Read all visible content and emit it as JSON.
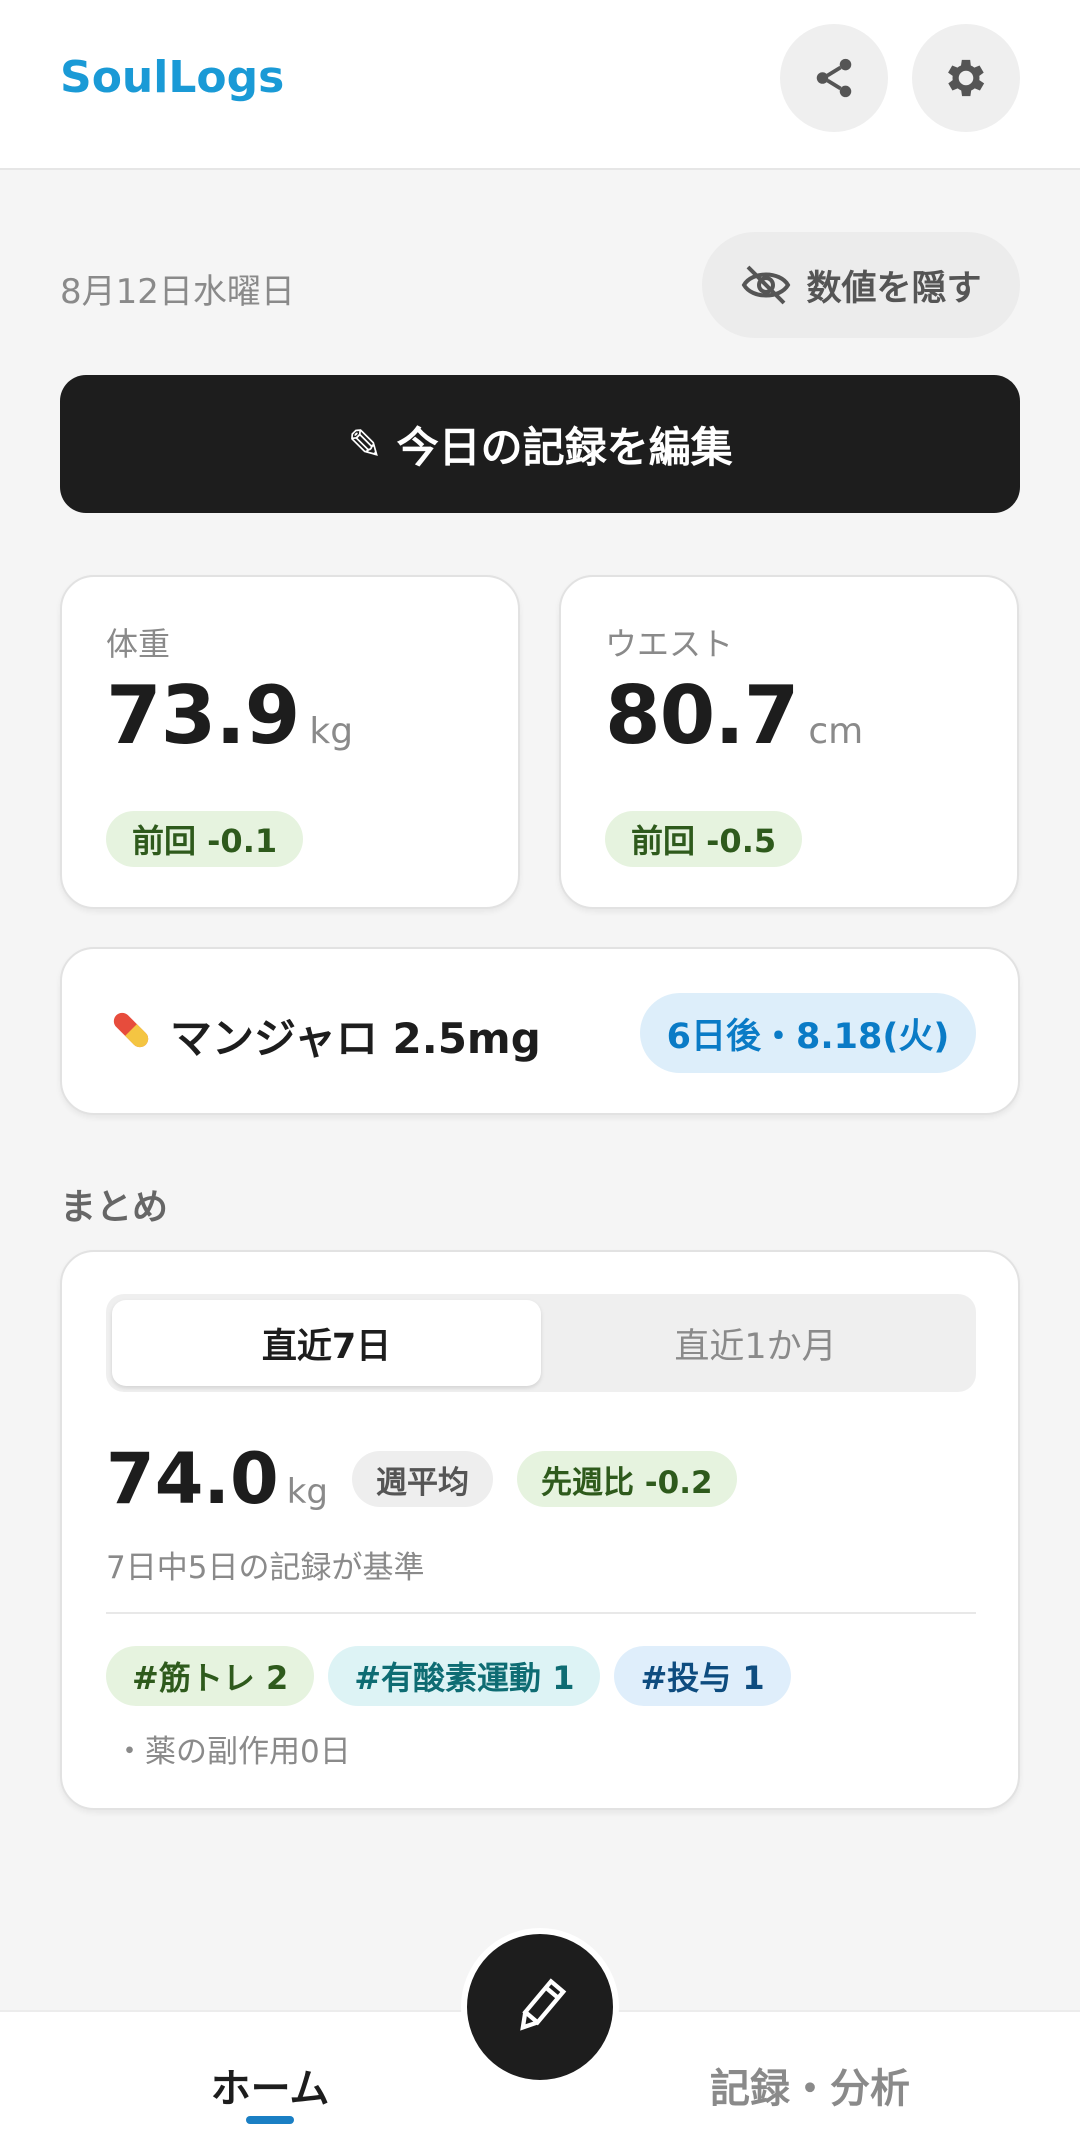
{
  "header": {
    "app_title": "SoulLogs",
    "share_icon": "share-icon",
    "settings_icon": "gear-icon"
  },
  "date_bar": {
    "date": "8月12日水曜日",
    "hide_values_label": "数値を隠す",
    "hide_icon": "eye-off-icon"
  },
  "edit_today": {
    "icon": "✎",
    "label": "今日の記録を編集"
  },
  "metrics": [
    {
      "label": "体重",
      "value": "73.9",
      "unit": "kg",
      "delta": "前回 -0.1"
    },
    {
      "label": "ウエスト",
      "value": "80.7",
      "unit": "cm",
      "delta": "前回 -0.5"
    }
  ],
  "medication": {
    "icon": "pill-icon",
    "name": "マンジャロ 2.5mg",
    "next_dose": "6日後・8.18(火)"
  },
  "summary": {
    "title": "まとめ",
    "tabs": [
      {
        "label": "直近7日",
        "selected": true
      },
      {
        "label": "直近1か月",
        "selected": false
      }
    ],
    "average_value": "74.0",
    "average_unit": "kg",
    "average_badge": "週平均",
    "compare_badge": "先週比 -0.2",
    "basis_text": "7日中5日の記録が基準",
    "tags": [
      "#筋トレ 2",
      "#有酸素運動 1",
      "#投与 1"
    ],
    "side_effect_text": "・薬の副作用0日"
  },
  "bottom_nav": {
    "home_label": "ホーム",
    "records_label": "記録・分析",
    "fab_icon": "pencil-icon"
  },
  "colors": {
    "accent": "#1a9ad6",
    "dark": "#1d1d1d",
    "green_bg": "#e6f3df",
    "blue_bg": "#ddeefa"
  }
}
